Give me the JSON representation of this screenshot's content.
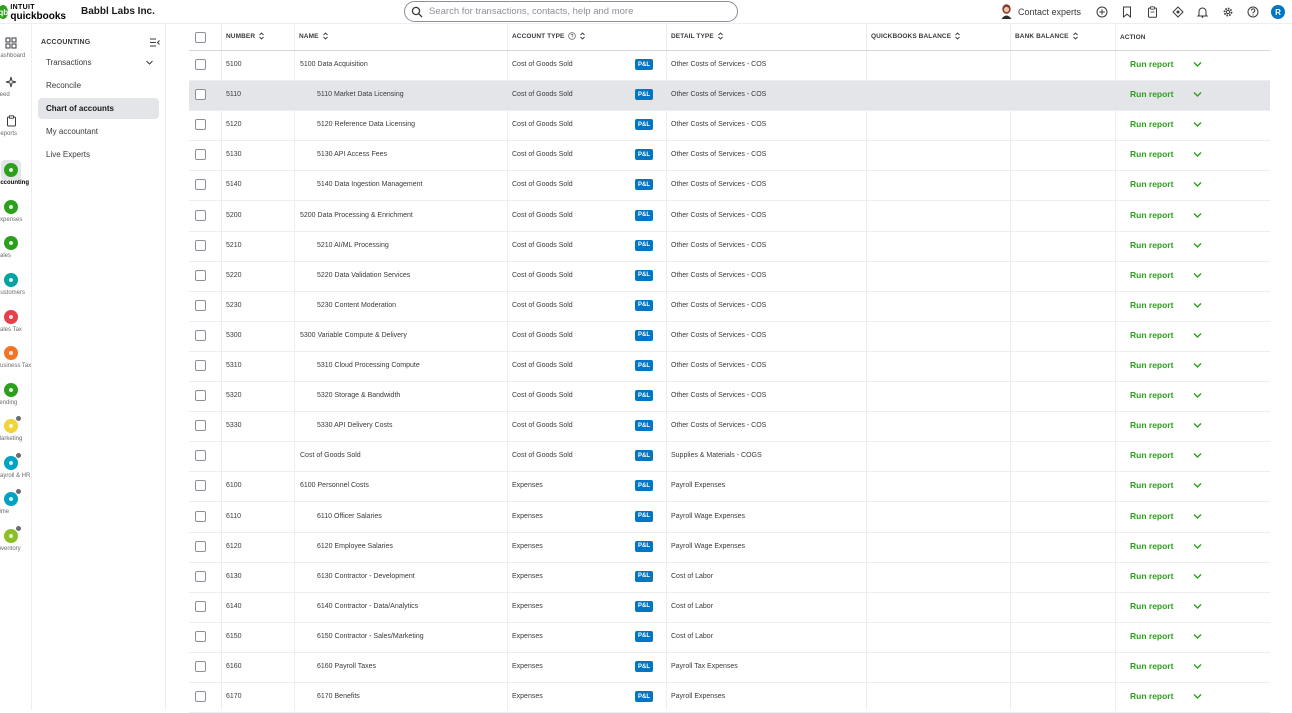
{
  "brand": {
    "intuit": "INTUIT",
    "product": "quickbooks",
    "logo_glyph": "qb"
  },
  "company": "Babbl Labs Inc.",
  "search": {
    "placeholder": "Search for transactions, contacts, help and more"
  },
  "header": {
    "contact_label": "Contact experts",
    "user_initial": "R"
  },
  "colors": {
    "brand_green": "#2ca01c",
    "pl_blue": "#0077c5",
    "hover_gray": "#e3e5e8"
  },
  "rail": [
    {
      "label": "Dashboard",
      "icon": "dashboard-icon"
    },
    {
      "label": "Feed",
      "icon": "feed-icon"
    },
    {
      "label": "Reports",
      "icon": "reports-icon"
    },
    {
      "label": "Accounting",
      "icon": "accounting-icon"
    },
    {
      "label": "Expenses",
      "icon": "expenses-icon"
    },
    {
      "label": "Sales",
      "icon": "sales-icon"
    },
    {
      "label": "Customers",
      "icon": "customers-icon"
    },
    {
      "label": "Sales Tax",
      "icon": "sales-tax-icon"
    },
    {
      "label": "Business Tax",
      "icon": "business-tax-icon"
    },
    {
      "label": "Lending",
      "icon": "lending-icon"
    },
    {
      "label": "Marketing",
      "icon": "marketing-icon"
    },
    {
      "label": "Payroll & HR",
      "icon": "payroll-icon"
    },
    {
      "label": "Time",
      "icon": "time-icon"
    },
    {
      "label": "Inventory",
      "icon": "inventory-icon"
    }
  ],
  "subnav": {
    "title": "ACCOUNTING",
    "items": [
      {
        "label": "Transactions"
      },
      {
        "label": "Reconcile"
      },
      {
        "label": "Chart of accounts"
      },
      {
        "label": "My accountant"
      },
      {
        "label": "Live Experts"
      }
    ]
  },
  "table": {
    "headers": {
      "number": "NUMBER",
      "name": "NAME",
      "account_type": "ACCOUNT TYPE",
      "detail_type": "DETAIL TYPE",
      "qb_balance": "QUICKBOOKS BALANCE",
      "bank_balance": "BANK BALANCE",
      "action": "ACTION"
    },
    "badge": "P&L",
    "action_label": "Run report",
    "rows": [
      {
        "number": "5100",
        "name": "5100 Data Acquisition",
        "sub": false,
        "type": "Cost of Goods Sold",
        "detail": "Other Costs of Services - COS"
      },
      {
        "number": "5110",
        "name": "5110 Market Data Licensing",
        "sub": true,
        "type": "Cost of Goods Sold",
        "detail": "Other Costs of Services - COS"
      },
      {
        "number": "5120",
        "name": "5120 Reference Data Licensing",
        "sub": true,
        "type": "Cost of Goods Sold",
        "detail": "Other Costs of Services - COS"
      },
      {
        "number": "5130",
        "name": "5130 API Access Fees",
        "sub": true,
        "type": "Cost of Goods Sold",
        "detail": "Other Costs of Services - COS"
      },
      {
        "number": "5140",
        "name": "5140 Data Ingestion Management",
        "sub": true,
        "type": "Cost of Goods Sold",
        "detail": "Other Costs of Services - COS"
      },
      {
        "number": "5200",
        "name": "5200 Data Processing & Enrichment",
        "sub": false,
        "type": "Cost of Goods Sold",
        "detail": "Other Costs of Services - COS"
      },
      {
        "number": "5210",
        "name": "5210 AI/ML Processing",
        "sub": true,
        "type": "Cost of Goods Sold",
        "detail": "Other Costs of Services - COS"
      },
      {
        "number": "5220",
        "name": "5220 Data Validation Services",
        "sub": true,
        "type": "Cost of Goods Sold",
        "detail": "Other Costs of Services - COS"
      },
      {
        "number": "5230",
        "name": "5230 Content Moderation",
        "sub": true,
        "type": "Cost of Goods Sold",
        "detail": "Other Costs of Services - COS"
      },
      {
        "number": "5300",
        "name": "5300 Variable Compute & Delivery",
        "sub": false,
        "type": "Cost of Goods Sold",
        "detail": "Other Costs of Services - COS"
      },
      {
        "number": "5310",
        "name": "5310 Cloud Processing Compute",
        "sub": true,
        "type": "Cost of Goods Sold",
        "detail": "Other Costs of Services - COS"
      },
      {
        "number": "5320",
        "name": "5320 Storage & Bandwidth",
        "sub": true,
        "type": "Cost of Goods Sold",
        "detail": "Other Costs of Services - COS"
      },
      {
        "number": "5330",
        "name": "5330 API Delivery Costs",
        "sub": true,
        "type": "Cost of Goods Sold",
        "detail": "Other Costs of Services - COS"
      },
      {
        "number": "",
        "name": "Cost of Goods Sold",
        "sub": false,
        "type": "Cost of Goods Sold",
        "detail": "Supplies & Materials - COGS"
      },
      {
        "number": "6100",
        "name": "6100 Personnel Costs",
        "sub": false,
        "type": "Expenses",
        "detail": "Payroll Expenses"
      },
      {
        "number": "6110",
        "name": "6110 Officer Salaries",
        "sub": true,
        "type": "Expenses",
        "detail": "Payroll Wage Expenses"
      },
      {
        "number": "6120",
        "name": "6120 Employee Salaries",
        "sub": true,
        "type": "Expenses",
        "detail": "Payroll Wage Expenses"
      },
      {
        "number": "6130",
        "name": "6130 Contractor - Development",
        "sub": true,
        "type": "Expenses",
        "detail": "Cost of Labor"
      },
      {
        "number": "6140",
        "name": "6140 Contractor - Data/Analytics",
        "sub": true,
        "type": "Expenses",
        "detail": "Cost of Labor"
      },
      {
        "number": "6150",
        "name": "6150 Contractor - Sales/Marketing",
        "sub": true,
        "type": "Expenses",
        "detail": "Cost of Labor"
      },
      {
        "number": "6160",
        "name": "6160 Payroll Taxes",
        "sub": true,
        "type": "Expenses",
        "detail": "Payroll Tax Expenses"
      },
      {
        "number": "6170",
        "name": "6170 Benefits",
        "sub": true,
        "type": "Expenses",
        "detail": "Payroll Expenses"
      }
    ]
  }
}
